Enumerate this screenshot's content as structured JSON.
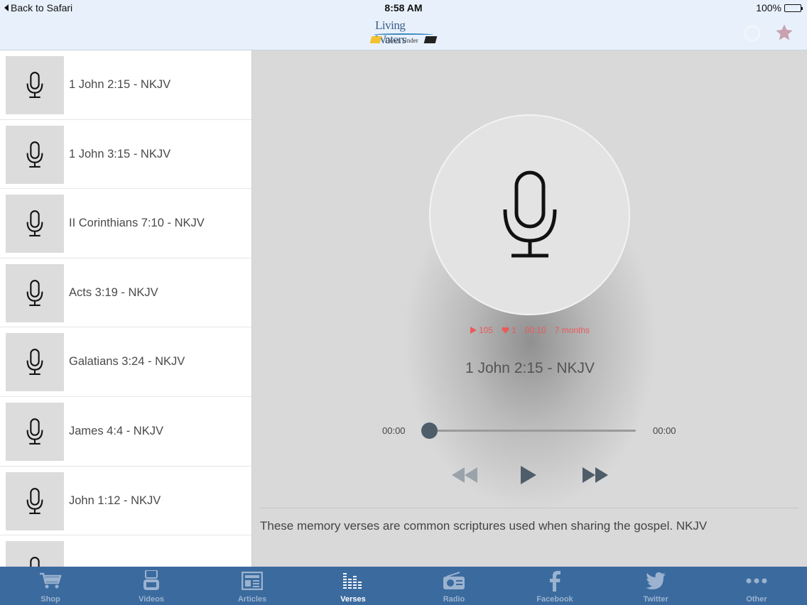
{
  "status_bar": {
    "back_label": "Back to Safari",
    "time": "8:58 AM",
    "battery": "100%"
  },
  "header": {
    "logo_line1": "Living Waters",
    "logo_line2": "Down Under"
  },
  "sidebar": {
    "items": [
      {
        "label": "1 John 2:15 - NKJV",
        "icon": "microphone-icon"
      },
      {
        "label": "1 John 3:15 - NKJV",
        "icon": "microphone-icon"
      },
      {
        "label": "II Corinthians 7:10 - NKJV",
        "icon": "microphone-icon"
      },
      {
        "label": "Acts 3:19 - NKJV",
        "icon": "microphone-icon"
      },
      {
        "label": "Galatians 3:24 - NKJV",
        "icon": "microphone-icon"
      },
      {
        "label": "James 4:4 - NKJV",
        "icon": "microphone-icon"
      },
      {
        "label": "John 1:12 - NKJV",
        "icon": "microphone-icon"
      },
      {
        "label": "",
        "icon": "microphone-icon"
      }
    ]
  },
  "player": {
    "plays": "105",
    "likes": "1",
    "duration": "00:10",
    "age": "7 months",
    "title": "1 John 2:15 - NKJV",
    "elapsed": "00:00",
    "remaining": "00:00",
    "progress": 0,
    "description": "These memory verses are common scriptures used when sharing the gospel. NKJV"
  },
  "tabs": [
    {
      "label": "Shop",
      "icon": "cart-icon",
      "active": false
    },
    {
      "label": "Videos",
      "icon": "youtube-icon",
      "active": false
    },
    {
      "label": "Articles",
      "icon": "newspaper-icon",
      "active": false
    },
    {
      "label": "Verses",
      "icon": "equalizer-icon",
      "active": true
    },
    {
      "label": "Radio",
      "icon": "radio-icon",
      "active": false
    },
    {
      "label": "Facebook",
      "icon": "facebook-icon",
      "active": false
    },
    {
      "label": "Twitter",
      "icon": "twitter-icon",
      "active": false
    },
    {
      "label": "Other",
      "icon": "more-dots-icon",
      "active": false
    }
  ],
  "colors": {
    "tab_bar": "#3b6a9e",
    "tab_inactive": "#9bb3cf",
    "stats_red": "#ea5a5a",
    "header_bg": "#e8f1fb"
  }
}
